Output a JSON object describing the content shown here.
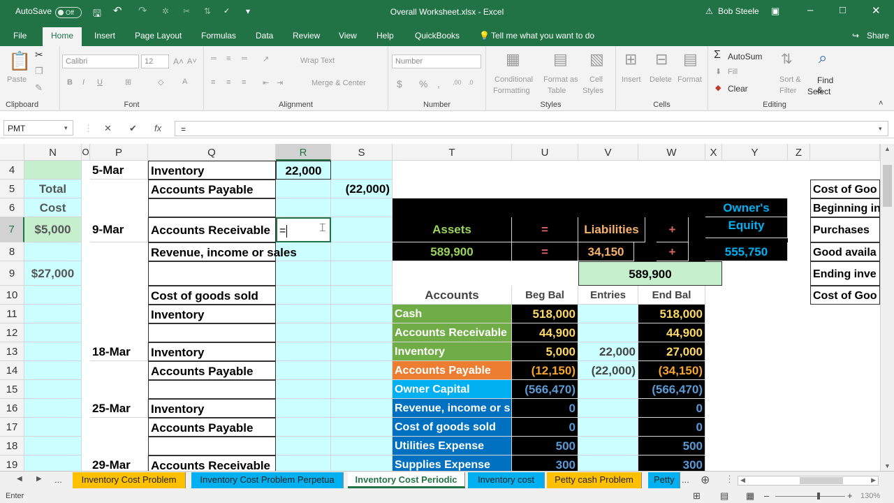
{
  "titlebar": {
    "autosave": "AutoSave",
    "autosave_state": "Off",
    "title": "Overall Worksheet.xlsx  -  Excel",
    "user": "Bob Steele"
  },
  "tabs": [
    "File",
    "Home",
    "Insert",
    "Page Layout",
    "Formulas",
    "Data",
    "Review",
    "View",
    "Help",
    "QuickBooks"
  ],
  "tell_me": "Tell me what you want to do",
  "share": "Share",
  "ribbon": {
    "clipboard": {
      "paste": "Paste",
      "label": "Clipboard"
    },
    "font": {
      "name": "Calibri",
      "size": "12",
      "label": "Font"
    },
    "alignment": {
      "wrap": "Wrap Text",
      "merge": "Merge & Center",
      "label": "Alignment"
    },
    "number": {
      "format": "Number",
      "label": "Number"
    },
    "styles": {
      "cond1": "Conditional",
      "cond2": "Formatting",
      "fmt1": "Format as",
      "fmt2": "Table",
      "cell1": "Cell",
      "cell2": "Styles",
      "label": "Styles"
    },
    "cells": {
      "insert": "Insert",
      "delete": "Delete",
      "format": "Format",
      "label": "Cells"
    },
    "editing": {
      "autosum": "AutoSum",
      "fill": "Fill",
      "clear": "Clear",
      "sort1": "Sort &",
      "sort2": "Filter",
      "find1": "Find &",
      "find2": "Select",
      "label": "Editing"
    }
  },
  "formula_bar": {
    "name_box": "PMT",
    "formula": "="
  },
  "columns": [
    "N",
    "O",
    "P",
    "Q",
    "R",
    "S",
    "T",
    "U",
    "V",
    "W",
    "X",
    "Y",
    "Z"
  ],
  "rows": [
    "4",
    "5",
    "6",
    "7",
    "8",
    "9",
    "10",
    "11",
    "12",
    "13",
    "14",
    "15",
    "16",
    "17",
    "18",
    "19"
  ],
  "cells": {
    "n5": "Total",
    "n6": "Cost",
    "n7": "$5,000",
    "n9": "$27,000",
    "p4": "5-Mar",
    "p7": "9-Mar",
    "p13": "18-Mar",
    "p16": "25-Mar",
    "p19": "29-Mar",
    "q4": "Inventory",
    "q5": "Accounts Payable",
    "q7": "Accounts Receivable",
    "q8": "Revenue, income or sales",
    "q10": "Cost of goods sold",
    "q11": "Inventory",
    "q13": "Inventory",
    "q14": "Accounts Payable",
    "q16": "Inventory",
    "q17": "Accounts Payable",
    "q19": "Accounts Receivable",
    "r4": "22,000",
    "r7": "=",
    "s5": "(22,000)",
    "eq_assets": "Assets",
    "eq_eq1": "=",
    "eq_liab": "Liabilities",
    "eq_plus1": "+",
    "eq_owner1": "Owner's",
    "eq_owner2": "Equity",
    "eq_assets_val": "589,900",
    "eq_eq2": "=",
    "eq_liab_val": "34,150",
    "eq_plus2": "+",
    "eq_owner_val": "555,750",
    "check_total": "589,900",
    "acc_hdr": "Accounts",
    "beg_hdr": "Beg Bal",
    "ent_hdr": "Entries",
    "end_hdr": "End Bal",
    "z5": "Cost of Goo",
    "z6": "Beginning in",
    "z7": "Purchases",
    "z8": "Good availa",
    "z9": "Ending inve",
    "z10": "Cost of Goo"
  },
  "accounts": [
    {
      "name": "Cash",
      "beg": "518,000",
      "entry": "",
      "end": "518,000",
      "bg": "#70ad47",
      "fg": "#ffffff"
    },
    {
      "name": "Accounts Receivable",
      "beg": "44,900",
      "entry": "",
      "end": "44,900",
      "bg": "#70ad47",
      "fg": "#ffffff"
    },
    {
      "name": "Inventory",
      "beg": "5,000",
      "entry": "22,000",
      "end": "27,000",
      "bg": "#70ad47",
      "fg": "#ffffff"
    },
    {
      "name": "Accounts Payable",
      "beg": "(12,150)",
      "entry": "(22,000)",
      "end": "(34,150)",
      "bg": "#ed7d31",
      "fg": "#ffffff"
    },
    {
      "name": "Owner Capital",
      "beg": "(566,470)",
      "entry": "",
      "end": "(566,470)",
      "bg": "#00b0f0",
      "fg": "#ffffff"
    },
    {
      "name": "Revenue, income or s",
      "beg": "0",
      "entry": "",
      "end": "0",
      "bg": "#0070c0",
      "fg": "#ffffff"
    },
    {
      "name": "Cost of goods sold",
      "beg": "0",
      "entry": "",
      "end": "0",
      "bg": "#0070c0",
      "fg": "#ffffff"
    },
    {
      "name": "Utilities Expense",
      "beg": "500",
      "entry": "",
      "end": "500",
      "bg": "#0070c0",
      "fg": "#ffffff"
    },
    {
      "name": "Supplies Expense",
      "beg": "300",
      "entry": "",
      "end": "300",
      "bg": "#0070c0",
      "fg": "#ffffff"
    }
  ],
  "sheet_tabs": [
    {
      "label": "Inventory Cost Problem",
      "bg": "#ffc000"
    },
    {
      "label": "Inventory Cost Problem Perpetua",
      "bg": "#00b0f0"
    },
    {
      "label": "Inventory Cost Periodic",
      "bg": "#ffffff"
    },
    {
      "label": "Inventory cost",
      "bg": "#00b0f0"
    },
    {
      "label": "Petty cash Problem",
      "bg": "#ffc000"
    },
    {
      "label": "Petty",
      "bg": "#00b0f0"
    }
  ],
  "sheet_more": "...",
  "status": {
    "mode": "Enter",
    "zoom": "130%"
  },
  "colors": {
    "excel_green": "#217346",
    "cyan_fill": "#ccffff",
    "light_green": "#c6efce",
    "black": "#000000"
  }
}
